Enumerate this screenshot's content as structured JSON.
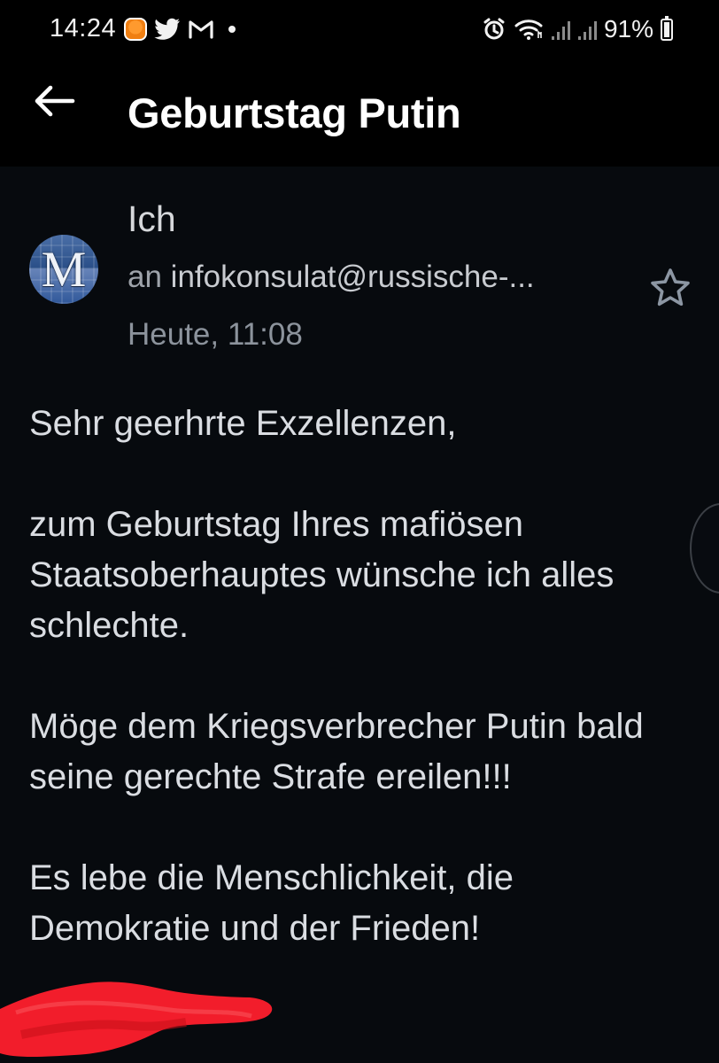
{
  "status_bar": {
    "time": "14:24",
    "battery": "91%",
    "left_icons": [
      "orange-app-icon",
      "twitter-icon",
      "gmail-icon"
    ],
    "right_icons": [
      "alarm-icon",
      "wifi-icon",
      "signal-icon",
      "signal-icon",
      "battery-icon"
    ]
  },
  "app_bar": {
    "back_icon": "arrow-back-icon",
    "title": "Geburtstag Putin"
  },
  "message": {
    "avatar_letter": "M",
    "sender": "Ich",
    "recipient_prefix": "an",
    "recipient_address": "infokonsulat@russische-...",
    "timestamp": "Heute, 11:08",
    "star_icon": "star-outline-icon",
    "body": [
      "Sehr geerhrte Exzellenzen,",
      "zum Geburtstag Ihres mafiösen Staatsoberhauptes wünsche ich alles schlechte.",
      "Möge dem Kriegsverbrecher Putin bald seine gerechte Strafe ereilen!!!",
      "Es lebe die Menschlichkeit, die Demokratie und der Frieden!"
    ]
  },
  "colors": {
    "background": "#070a0e",
    "app_bar": "#000000",
    "body_text": "#dadde2",
    "secondary_text": "#9ea3aa",
    "redaction": "#ff1f2d"
  }
}
